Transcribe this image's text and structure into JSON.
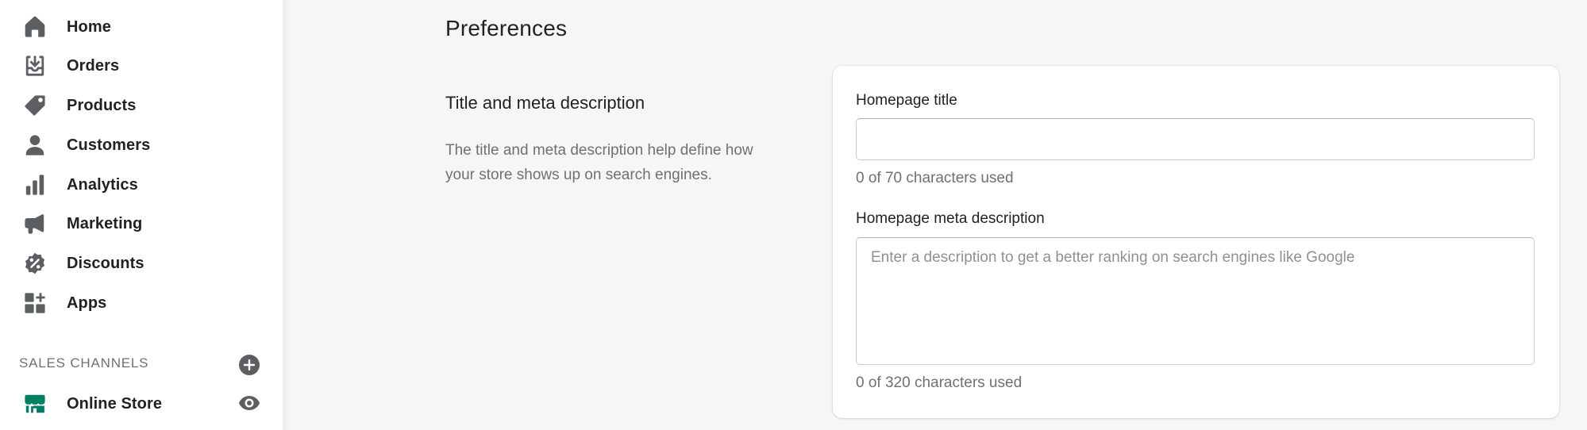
{
  "sidebar": {
    "items": [
      {
        "label": "Home",
        "icon": "home-icon"
      },
      {
        "label": "Orders",
        "icon": "orders-icon"
      },
      {
        "label": "Products",
        "icon": "tag-icon"
      },
      {
        "label": "Customers",
        "icon": "person-icon"
      },
      {
        "label": "Analytics",
        "icon": "bar-chart-icon"
      },
      {
        "label": "Marketing",
        "icon": "megaphone-icon"
      },
      {
        "label": "Discounts",
        "icon": "discount-icon"
      },
      {
        "label": "Apps",
        "icon": "apps-icon"
      }
    ],
    "sales_channels": {
      "header": "SALES CHANNELS",
      "online_store": {
        "label": "Online Store",
        "icon": "storefront-icon"
      }
    }
  },
  "main": {
    "page_title": "Preferences",
    "section": {
      "title": "Title and meta description",
      "description": "The title and meta description help define how your store shows up on search engines."
    },
    "fields": {
      "homepage_title": {
        "label": "Homepage title",
        "value": "",
        "help": "0 of 70 characters used"
      },
      "meta_description": {
        "label": "Homepage meta description",
        "value": "",
        "placeholder": "Enter a description to get a better ranking on search engines like Google",
        "help": "0 of 320 characters used"
      }
    }
  },
  "colors": {
    "icon": "#5c5f62",
    "online_store_icon": "#008060",
    "background": "#f6f6f7"
  }
}
